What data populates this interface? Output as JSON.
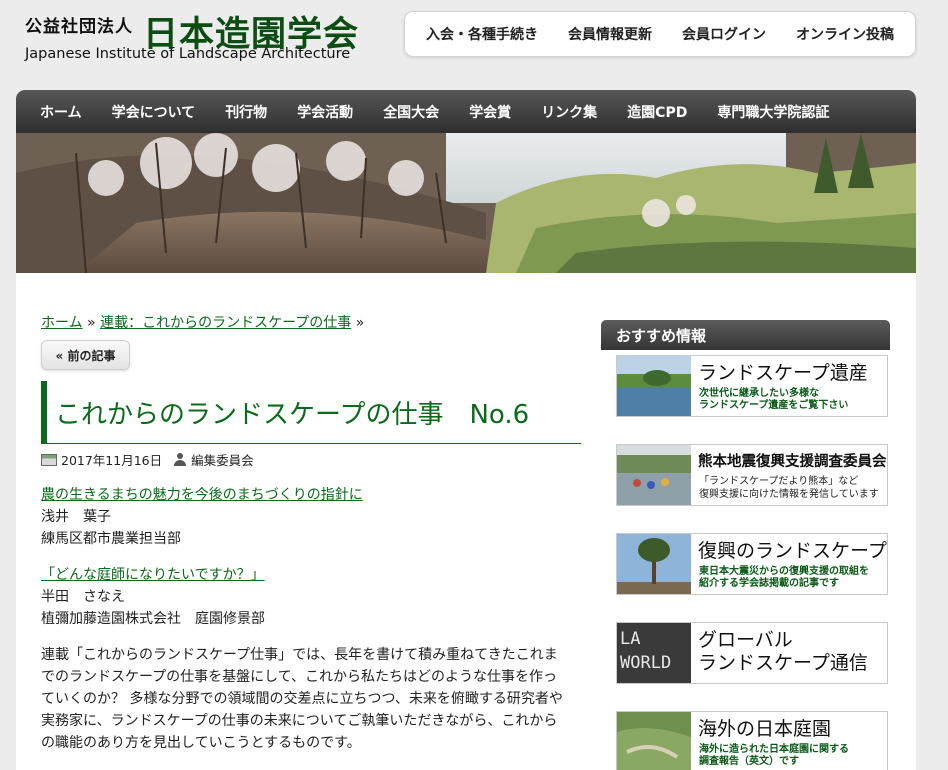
{
  "brand": {
    "prefix": "公益社団法人",
    "name": "日本造園学会",
    "english": "Japanese Institute of Landscape Architecture"
  },
  "top_nav": [
    "入会・各種手続き",
    "会員情報更新",
    "会員ログイン",
    "オンライン投稿"
  ],
  "main_nav": [
    "ホーム",
    "学会について",
    "刊行物",
    "学会活動",
    "全国大会",
    "学会賞",
    "リンク集",
    "造園CPD",
    "専門職大学院認証"
  ],
  "breadcrumb": {
    "home": "ホーム",
    "sep": "»",
    "category": "連載：これからのランドスケープの仕事"
  },
  "prev_button": "« 前の記事",
  "post": {
    "title": "これからのランドスケープの仕事　No.6",
    "date": "2017年11月16日",
    "author": "編集委員会",
    "entries": [
      {
        "link": "農の生きるまちの魅力を今後のまちづくりの指針に",
        "name": "浅井　葉子",
        "org": "練馬区都市農業担当部"
      },
      {
        "link": "「どんな庭師になりたいですか？」",
        "name": "半田　さなえ",
        "org": "植彌加藤造園株式会社　庭園修景部"
      }
    ],
    "body_lines": [
      "連載「これからのランドスケープ仕事」では、長年を書けて積み重ねてきたこれま",
      "でのランドスケープの仕事を基盤にして、これから私たちはどのような仕事を作っ",
      "ていくのか？ 多様な分野での領域間の交差点に立ちつつ、未来を俯瞰する研究者や",
      "実務家に、ランドスケープの仕事の未来についてご執筆いただきながら、これから",
      "の職能のあり方を見出していこうとするものです。"
    ]
  },
  "sidebar": {
    "heading": "おすすめ情報",
    "banners": [
      {
        "title": "ランドスケープ遺産",
        "sub1": "次世代に継承したい多様な",
        "sub2": "ランドスケープ遺産をご覧下さい"
      },
      {
        "title": "熊本地震復興支援調査委員会",
        "sub1": "「ランドスケープだより熊本」など",
        "sub2": "復興支援に向けた情報を発信しています"
      },
      {
        "title": "復興のランドスケープ",
        "sub1": "東日本大震災からの復興支援の取組を",
        "sub2": "紹介する学会誌掲載の記事です"
      },
      {
        "title1": "グローバル",
        "title2": "ランドスケープ通信",
        "logo1": "LA",
        "logo2": "WORLD"
      },
      {
        "title": "海外の日本庭園",
        "sub1": "海外に造られた日本庭園に関する",
        "sub2": "調査報告（英文）です"
      }
    ]
  },
  "colors": {
    "accent": "#0b6a1c",
    "nav": "#3a3a3a"
  }
}
